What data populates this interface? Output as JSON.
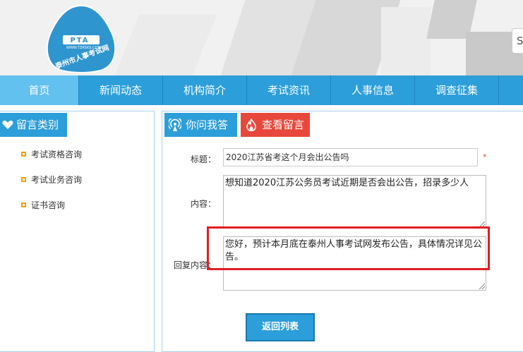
{
  "header": {
    "logo": {
      "abbr": "PTA",
      "url_text": "WWW.TZRSKS.COM",
      "site_name": "泰州市人事考试网"
    },
    "search_partial": "S"
  },
  "nav": {
    "items": [
      {
        "label": "首页",
        "active": true
      },
      {
        "label": "新闻动态"
      },
      {
        "label": "机构简介"
      },
      {
        "label": "考试资讯"
      },
      {
        "label": "人事信息"
      },
      {
        "label": "调查征集"
      }
    ]
  },
  "sidebar": {
    "title": "留言类别",
    "icon": "heart-icon",
    "items": [
      {
        "label": "考试资格咨询"
      },
      {
        "label": "考试业务咨询"
      },
      {
        "label": "证书咨询"
      }
    ]
  },
  "main": {
    "tabs": [
      {
        "label": "你问我答",
        "icon": "signal-icon",
        "color": "#2c9ed9"
      },
      {
        "label": "查看留言",
        "icon": "fire-icon",
        "color": "#e8483b"
      }
    ],
    "form": {
      "title_label": "标题：",
      "title_value": "2020江苏省考这个月会出公告吗",
      "required_mark": "*",
      "content_label": "内容：",
      "content_value": "想知道2020江苏公务员考试近期是否会出公告，招录多少人",
      "reply_label": "回复内容：",
      "reply_value": "您好，预计本月底在泰州人事考试网发布公告，具体情况详见公告。"
    },
    "back_button": "返回列表"
  },
  "colors": {
    "accent": "#2c9ed9",
    "accent_light": "#62c1ee",
    "alert": "#e8483b",
    "highlight": "#e21c24",
    "bullet": "#f5a100"
  }
}
